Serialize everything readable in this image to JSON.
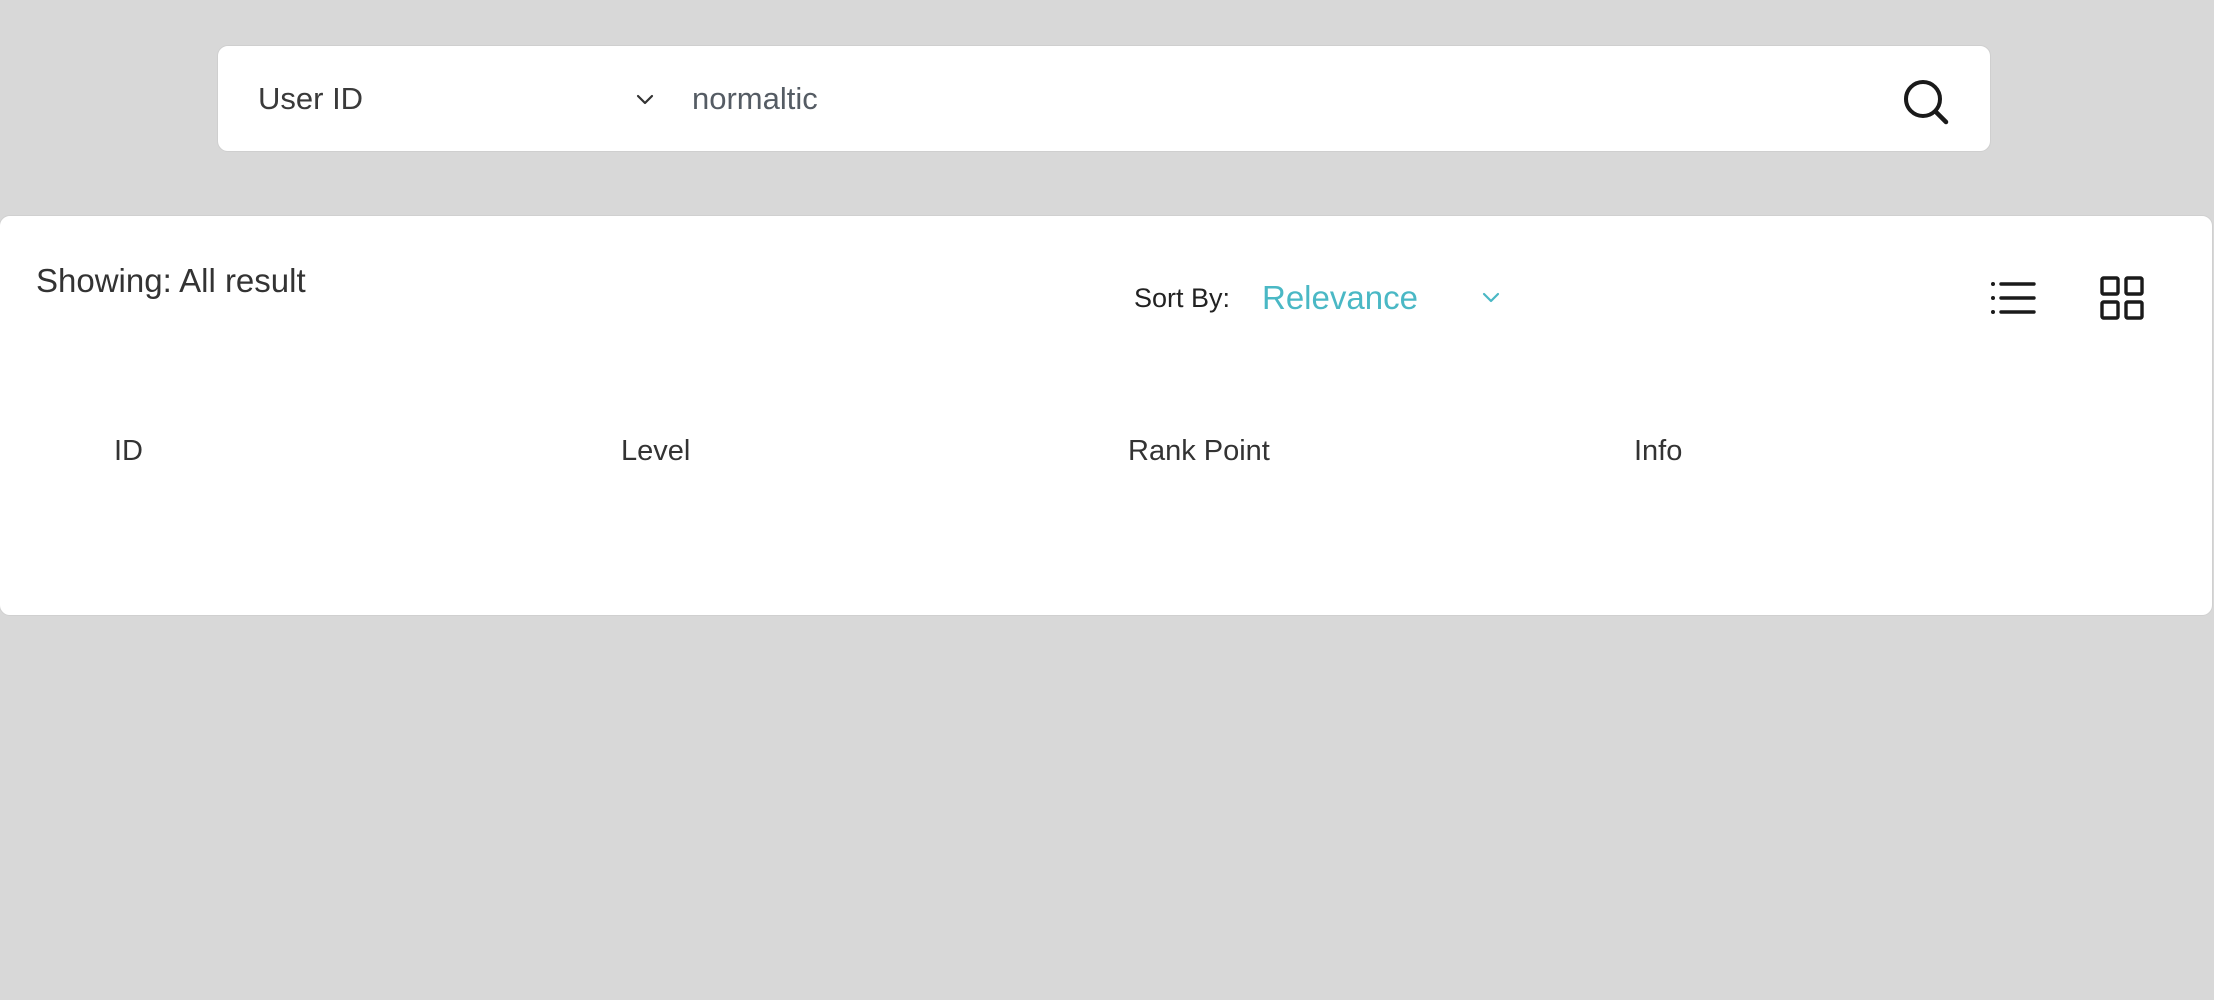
{
  "search": {
    "field_selector": {
      "selected": "User ID",
      "icon": "chevron-down-icon"
    },
    "input": {
      "value": "normaltic",
      "placeholder": ""
    },
    "submit_icon": "search-icon"
  },
  "results": {
    "showing_text": "Showing: All result",
    "sort": {
      "label": "Sort By:",
      "selected": "Relevance",
      "icon": "chevron-down-icon"
    },
    "view_toggles": {
      "list_icon": "list-view-icon",
      "grid_icon": "grid-view-icon"
    },
    "table": {
      "columns": [
        "ID",
        "Level",
        "Rank Point",
        "Info"
      ],
      "rows": []
    }
  },
  "colors": {
    "page_background": "#d8d8d8",
    "panel_background": "#ffffff",
    "accent": "#4ab8c5",
    "text": "#333333"
  }
}
